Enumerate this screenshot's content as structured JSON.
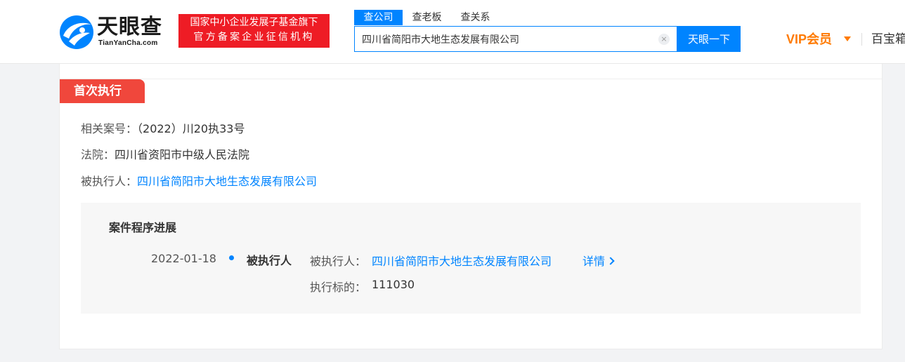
{
  "header": {
    "logo_cn": "天眼查",
    "logo_en": "TianYanCha.com",
    "badge_line1": "国家中小企业发展子基金旗下",
    "badge_line2": "官方备案企业征信机构",
    "search_tabs": [
      {
        "label": "查公司",
        "active": true
      },
      {
        "label": "查老板",
        "active": false
      },
      {
        "label": "查关系",
        "active": false
      }
    ],
    "search_value": "四川省简阳市大地生态发展有限公司",
    "clear_symbol": "×",
    "search_button": "天眼一下",
    "vip_label": "VIP会员",
    "more_link": "百宝箱"
  },
  "colors": {
    "brand_blue": "#0084ff",
    "badge_red": "#ee1c25",
    "tag_red": "#f0473c",
    "vip_orange": "#ff7a00"
  },
  "section": {
    "tag": "首次执行",
    "case_no_label": "相关案号：",
    "case_no": "（2022）川20执33号",
    "court_label": "法院：",
    "court": "四川省资阳市中级人民法院",
    "executed_label": "被执行人：",
    "executed": "四川省简阳市大地生态发展有限公司"
  },
  "progress": {
    "title": "案件程序进展",
    "items": [
      {
        "date": "2022-01-18",
        "type": "被执行人",
        "party_label": "被执行人：",
        "party": "四川省简阳市大地生态发展有限公司",
        "detail": "详情",
        "amount_label": "执行标的：",
        "amount": "111030"
      }
    ]
  }
}
